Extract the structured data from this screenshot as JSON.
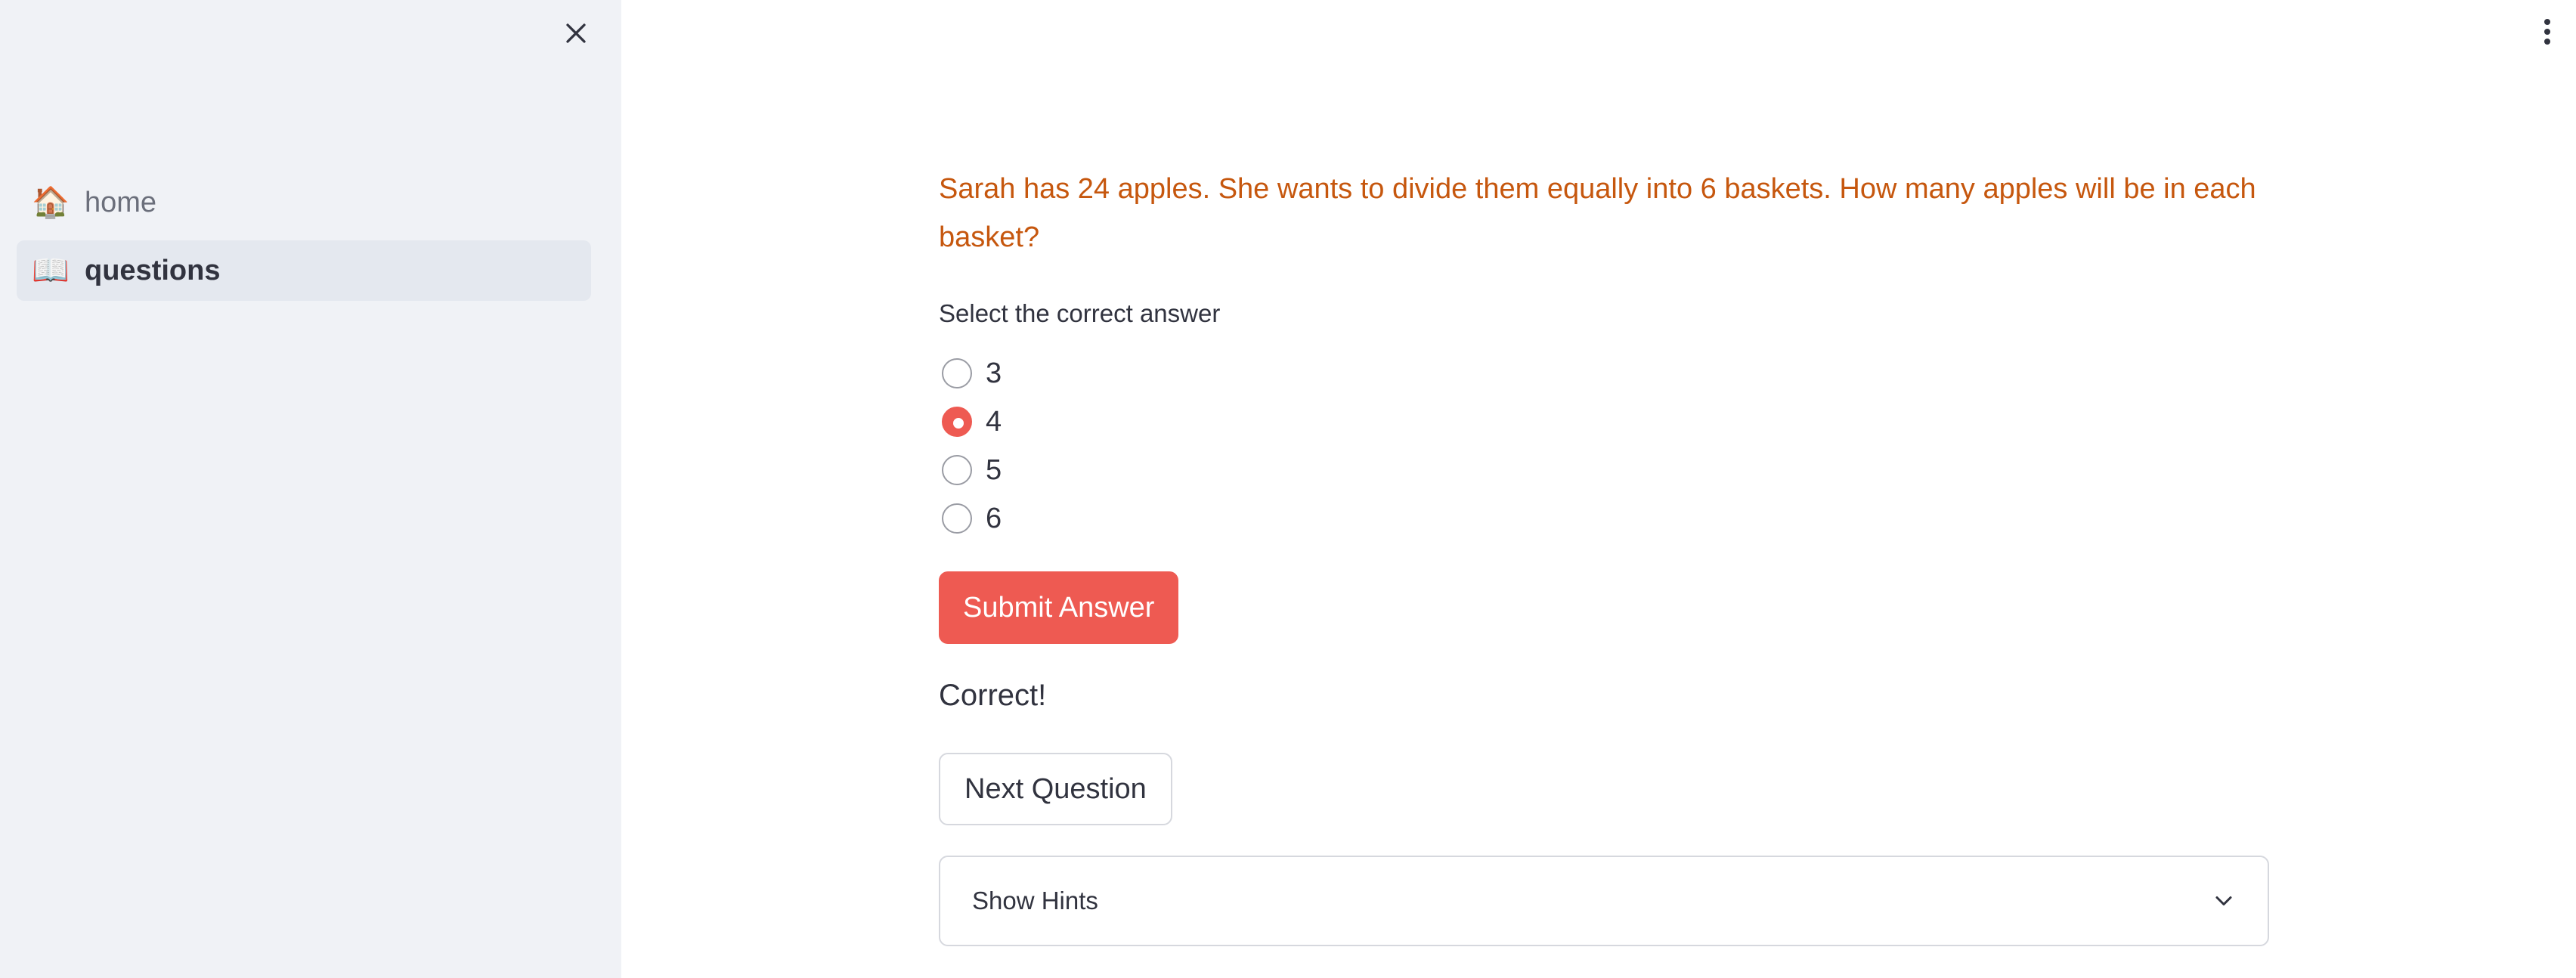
{
  "sidebar": {
    "close_icon": "close-icon",
    "items": [
      {
        "icon": "🏠",
        "icon_name": "house-icon",
        "label": "home",
        "active": false
      },
      {
        "icon": "📖",
        "icon_name": "open-book-icon",
        "label": "questions",
        "active": true
      }
    ]
  },
  "header": {
    "menu_icon": "kebab-menu-icon"
  },
  "main": {
    "question": "Sarah has 24 apples. She wants to divide them equally into 6 baskets. How many apples will be in each basket?",
    "select_label": "Select the correct answer",
    "options": [
      "3",
      "4",
      "5",
      "6"
    ],
    "selected_option": "4",
    "submit_label": "Submit Answer",
    "result": "Correct!",
    "next_label": "Next Question",
    "hints_label": "Show Hints"
  },
  "colors": {
    "question_text": "#c6570e",
    "primary": "#ee5a52",
    "sidebar_bg": "#f0f2f6"
  }
}
